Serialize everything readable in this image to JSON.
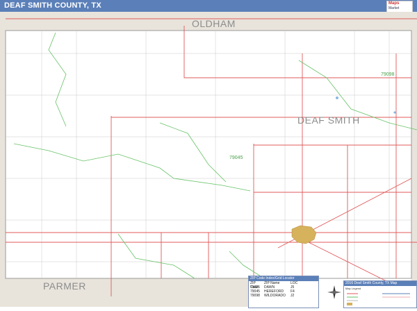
{
  "header": {
    "title": "DEAF SMITH COUNTY, TX",
    "logo_line1": "Maps",
    "logo_line2": "Market"
  },
  "map": {
    "county_labels": {
      "north": "OLDHAM",
      "center": "DEAF SMITH",
      "southwest": "PARMER"
    },
    "zip_labels": [
      "79098",
      "79045"
    ],
    "colors": {
      "road": "#e05a5a",
      "zip_boundary": "#66c266",
      "minor_road": "#b8b8b8",
      "adjacent_county": "#e8e4dc",
      "city": "#d6b25c",
      "header": "#5b7fb8"
    }
  },
  "zip_table": {
    "title": "ZIP Code Index/Grid Locator",
    "columns": [
      "ZIP Code",
      "ZIP Name",
      "LOC"
    ],
    "rows": [
      [
        "79025",
        "DAWN",
        "J5"
      ],
      [
        "79045",
        "HEREFORD",
        "F4"
      ],
      [
        "79098",
        "WILDORADO",
        "J2"
      ]
    ]
  },
  "legend": {
    "title": "2016 Deaf Smith County, TX Map",
    "subtitle": "Map Legend"
  }
}
